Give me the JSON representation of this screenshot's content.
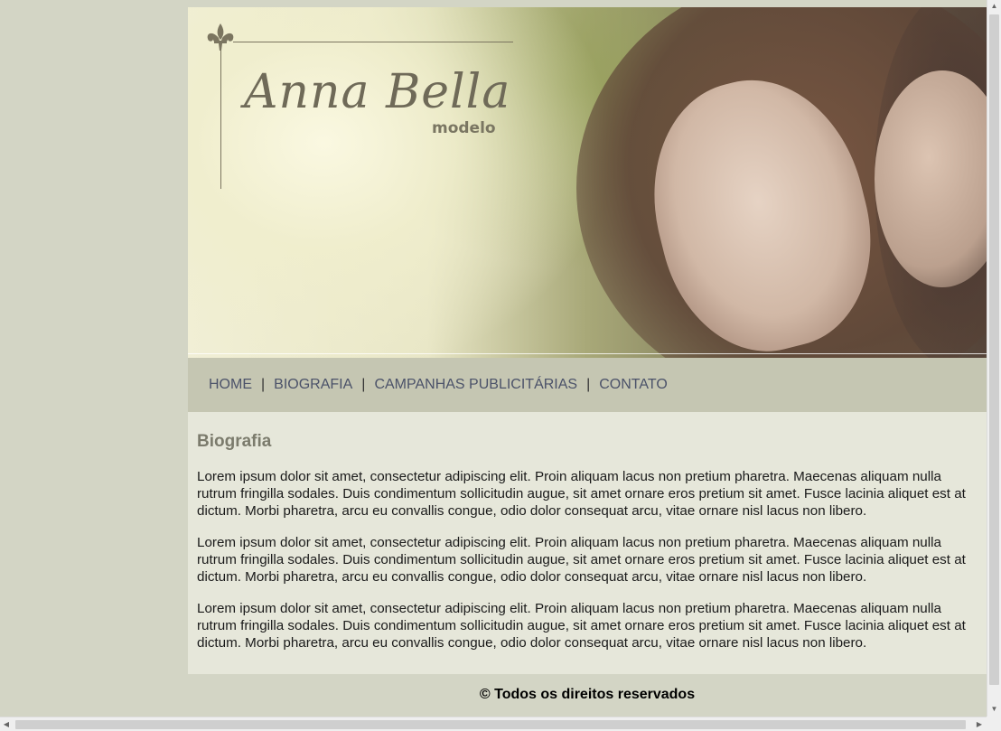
{
  "banner": {
    "logo_name": "Anna Bella",
    "logo_subtitle": "modelo",
    "icon": "fleur-de-lis-icon"
  },
  "nav": {
    "items": [
      {
        "label": "HOME"
      },
      {
        "label": "BIOGRAFIA"
      },
      {
        "label": "CAMPANHAS PUBLICITÁRIAS"
      },
      {
        "label": "CONTATO"
      }
    ],
    "separator": "|"
  },
  "content": {
    "heading": "Biografia",
    "paragraphs": [
      "Lorem ipsum dolor sit amet, consectetur adipiscing elit. Proin aliquam lacus non pretium pharetra. Maecenas aliquam nulla rutrum fringilla sodales. Duis condimentum sollicitudin augue, sit amet ornare eros pretium sit amet. Fusce lacinia aliquet est at dictum. Morbi pharetra, arcu eu convallis congue, odio dolor consequat arcu, vitae ornare nisl lacus non libero.",
      "Lorem ipsum dolor sit amet, consectetur adipiscing elit. Proin aliquam lacus non pretium pharetra. Maecenas aliquam nulla rutrum fringilla sodales. Duis condimentum sollicitudin augue, sit amet ornare eros pretium sit amet. Fusce lacinia aliquet est at dictum. Morbi pharetra, arcu eu convallis congue, odio dolor consequat arcu, vitae ornare nisl lacus non libero.",
      "Lorem ipsum dolor sit amet, consectetur adipiscing elit. Proin aliquam lacus non pretium pharetra. Maecenas aliquam nulla rutrum fringilla sodales. Duis condimentum sollicitudin augue, sit amet ornare eros pretium sit amet. Fusce lacinia aliquet est at dictum. Morbi pharetra, arcu eu convallis congue, odio dolor consequat arcu, vitae ornare nisl lacus non libero."
    ]
  },
  "footer": {
    "text": "© Todos os direitos reservados"
  },
  "colors": {
    "page_background": "#d3d5c5",
    "nav_background": "#c5c6b2",
    "nav_link": "#4b5269",
    "content_background": "#e6e7da",
    "heading": "#7b7b6c"
  }
}
